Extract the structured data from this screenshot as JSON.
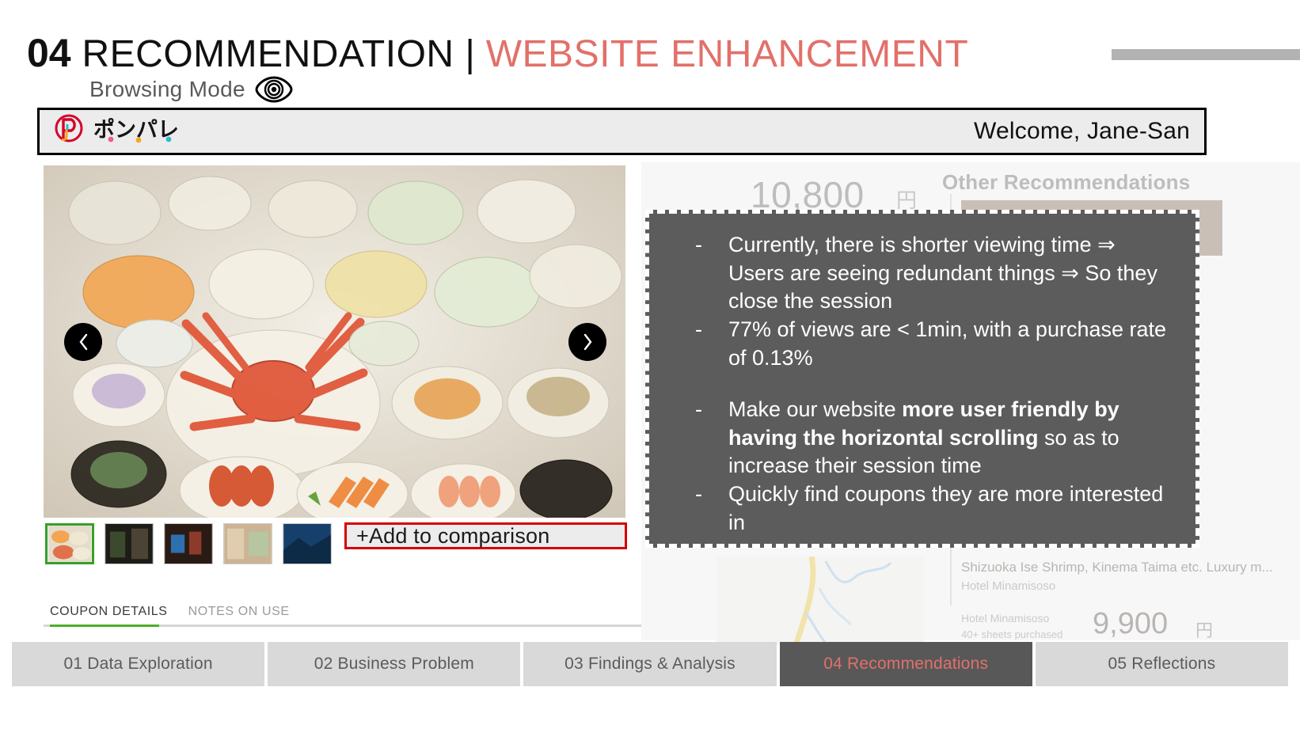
{
  "title": {
    "number": "04",
    "main": "RECOMMENDATION",
    "separator": "|",
    "accent": "WEBSITE ENHANCEMENT"
  },
  "subtitle": {
    "text": "Browsing Mode",
    "icon": "eye-icon"
  },
  "browser": {
    "logo_text": "ポンパレ",
    "welcome": "Welcome, Jane-San"
  },
  "gallery": {
    "prev_label": "‹",
    "next_label": "›",
    "compare_button": "+Add to comparison",
    "thumbnails": [
      {
        "name": "thumb-food",
        "selected": true
      },
      {
        "name": "thumb-interior-dark",
        "selected": false
      },
      {
        "name": "thumb-lobby",
        "selected": false
      },
      {
        "name": "thumb-room",
        "selected": false
      },
      {
        "name": "thumb-exterior-night",
        "selected": false
      }
    ]
  },
  "detail_tabs": [
    {
      "label": "COUPON DETAILS",
      "active": true
    },
    {
      "label": "NOTES ON USE",
      "active": false
    }
  ],
  "right_panel": {
    "price": "10,800",
    "price_unit": "円",
    "other_recommendations": "Other Recommendations",
    "rec_item": {
      "title": "Shizuoka Ise Shrimp, Kinema Taima etc. Luxury m...",
      "hotel": "Hotel Minamisoso",
      "hotel2": "Hotel Minamisoso",
      "sheets": "40+ sheets purchased",
      "price": "9,900",
      "price_unit": "円"
    }
  },
  "note": {
    "bullets": [
      {
        "text": "Currently, there is shorter viewing time ⇒ Users are seeing redundant things ⇒ So they close the session",
        "gap": false,
        "bold_part": ""
      },
      {
        "text": "77% of views are < 1min, with a purchase rate of 0.13%",
        "gap": false,
        "bold_part": ""
      },
      {
        "text": "Make our website ",
        "gap": true,
        "bold_part": "more user friendly by having the horizontal scrolling",
        "text_after": " so as to increase their session time"
      },
      {
        "text": "Quickly find coupons they are more interested in",
        "gap": false,
        "bold_part": ""
      }
    ]
  },
  "bottom_nav": [
    {
      "label": "01 Data Exploration",
      "active": false
    },
    {
      "label": "02 Business Problem",
      "active": false
    },
    {
      "label": "03 Findings & Analysis",
      "active": false
    },
    {
      "label": "04 Recommendations",
      "active": true
    },
    {
      "label": "05 Reflections",
      "active": false
    }
  ],
  "colors": {
    "accent_red": "#e2706a",
    "note_bg": "#5c5c5c",
    "nav_active_bg": "#585858",
    "tab_green": "#4caf27",
    "compare_border": "#d40000"
  }
}
